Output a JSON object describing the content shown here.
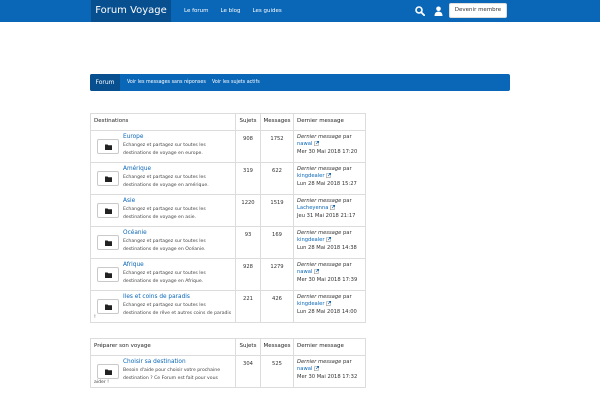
{
  "header": {
    "brand": "Forum Voyage",
    "nav": [
      "Le forum",
      "Le blog",
      "Les guides"
    ],
    "member_button": "Devenir membre",
    "icons": [
      "search-icon",
      "user-icon"
    ]
  },
  "subnav": {
    "active": "Forum",
    "items": [
      "Voir les messages sans réponses",
      "Voir les sujets actifs"
    ]
  },
  "table_headers": {
    "topics": "Sujets",
    "messages": "Messages",
    "last": "Dernier message"
  },
  "last_message_label": "Dernier message",
  "by_label": "par",
  "sections": [
    {
      "title": "Destinations",
      "forums": [
        {
          "name": "Europe",
          "desc": "Echangez et partagez sur toutes les destinations de voyage en europe.",
          "topics": "908",
          "messages": "1752",
          "author": "nawal",
          "date": "Mer 30 Mai 2018 17:20"
        },
        {
          "name": "Amérique",
          "desc": "Echangez et partagez sur toutes les destinations de voyage en amérique.",
          "topics": "319",
          "messages": "622",
          "author": "kingdealer",
          "date": "Lun 28 Mai 2018 15:27"
        },
        {
          "name": "Asie",
          "desc": "Echangez et partagez sur toutes les destinations de voyage en asie.",
          "topics": "1220",
          "messages": "1519",
          "author": "Lacheyenna",
          "date": "Jeu 31 Mai 2018 21:17"
        },
        {
          "name": "Océanie",
          "desc": "Echangez et partagez sur toutes les destinations de voyage en Océanie.",
          "topics": "93",
          "messages": "169",
          "author": "kingdealer",
          "date": "Lun 28 Mai 2018 14:38"
        },
        {
          "name": "Afrique",
          "desc": "Echangez et partagez sur toutes les destinations de voyage en Afrique.",
          "topics": "928",
          "messages": "1279",
          "author": "nawal",
          "date": "Mer 30 Mai 2018 17:39"
        },
        {
          "name": "Iles et coins de paradis",
          "desc": "Echangez et partagez sur toutes les destinations de rêve et autres coins de paradis",
          "extra": "!",
          "topics": "221",
          "messages": "426",
          "author": "kingdealer",
          "date": "Lun 28 Mai 2018 14:00"
        }
      ]
    },
    {
      "title": "Préparer son voyage",
      "forums": [
        {
          "name": "Choisir sa destination",
          "desc": "Besoin d'aide pour choisir votre prochaine destination ? Ce Forum est fait pour vous",
          "extra": "aider !",
          "topics": "304",
          "messages": "525",
          "author": "nawal",
          "date": "Mer 30 Mai 2018 17:32"
        }
      ]
    }
  ],
  "colors": {
    "primary": "#0a67b8",
    "primary_dark": "#084f90",
    "border": "#dcdcdc"
  }
}
